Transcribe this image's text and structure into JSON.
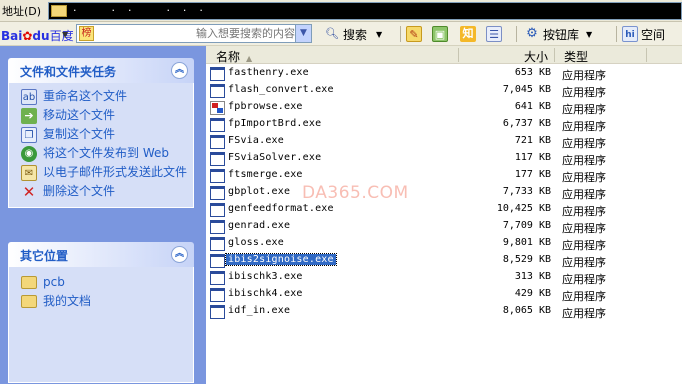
{
  "address_bar": {
    "label": "地址",
    "hotkey": "(D)",
    "path": "·      ·  ·      ·  ·  ·"
  },
  "toolbar": {
    "baidu_bai": "Bai",
    "baidu_du": "du",
    "baidu_name": "百度",
    "search_placeholder": "输入想要搜索的内容",
    "search_button": "搜索",
    "plugin_library": "按钮库",
    "space": "空间",
    "toolbar_badge": "榜"
  },
  "task_pane": {
    "file_tasks": {
      "title": "文件和文件夹任务",
      "items": [
        {
          "label": "重命名这个文件",
          "icon": "rename-icon"
        },
        {
          "label": "移动这个文件",
          "icon": "move-icon"
        },
        {
          "label": "复制这个文件",
          "icon": "copy-icon"
        },
        {
          "label": "将这个文件发布到 Web",
          "icon": "publish-web-icon"
        },
        {
          "label": "以电子邮件形式发送此文件",
          "icon": "email-icon"
        },
        {
          "label": "删除这个文件",
          "icon": "delete-icon"
        }
      ]
    },
    "other_places": {
      "title": "其它位置",
      "items": [
        {
          "label": "pcb",
          "icon": "folder-icon"
        },
        {
          "label": "我的文档",
          "icon": "my-documents-icon"
        }
      ]
    }
  },
  "file_list": {
    "columns": {
      "name": "名称",
      "size": "大小",
      "type": "类型"
    },
    "rows": [
      {
        "name": "fasthenry.exe",
        "size": "653 KB",
        "type": "应用程序",
        "icon": "exe-icon"
      },
      {
        "name": "flash_convert.exe",
        "size": "7,045 KB",
        "type": "应用程序",
        "icon": "exe-icon"
      },
      {
        "name": "fpbrowse.exe",
        "size": "641 KB",
        "type": "应用程序",
        "icon": "app-color-icon"
      },
      {
        "name": "fpImportBrd.exe",
        "size": "6,737 KB",
        "type": "应用程序",
        "icon": "exe-icon"
      },
      {
        "name": "FSvia.exe",
        "size": "721 KB",
        "type": "应用程序",
        "icon": "exe-icon"
      },
      {
        "name": "FSviaSolver.exe",
        "size": "117 KB",
        "type": "应用程序",
        "icon": "exe-icon"
      },
      {
        "name": "ftsmerge.exe",
        "size": "177 KB",
        "type": "应用程序",
        "icon": "exe-icon"
      },
      {
        "name": "gbplot.exe",
        "size": "7,733 KB",
        "type": "应用程序",
        "icon": "exe-icon"
      },
      {
        "name": "genfeedformat.exe",
        "size": "10,425 KB",
        "type": "应用程序",
        "icon": "exe-icon"
      },
      {
        "name": "genrad.exe",
        "size": "7,709 KB",
        "type": "应用程序",
        "icon": "exe-icon"
      },
      {
        "name": "gloss.exe",
        "size": "9,801 KB",
        "type": "应用程序",
        "icon": "exe-icon"
      },
      {
        "name": "ibis2signoise.exe",
        "size": "8,529 KB",
        "type": "应用程序",
        "icon": "exe-icon",
        "selected": true
      },
      {
        "name": "ibischk3.exe",
        "size": "313 KB",
        "type": "应用程序",
        "icon": "exe-icon"
      },
      {
        "name": "ibischk4.exe",
        "size": "429 KB",
        "type": "应用程序",
        "icon": "exe-icon"
      },
      {
        "name": "idf_in.exe",
        "size": "8,065 KB",
        "type": "应用程序",
        "icon": "exe-icon"
      }
    ]
  },
  "watermark": "DA365.COM",
  "colors": {
    "taskpane_bg": "#7a96df",
    "task_link": "#215dc6",
    "selection": "#316ac5",
    "watermark": "#f7b3a8"
  }
}
